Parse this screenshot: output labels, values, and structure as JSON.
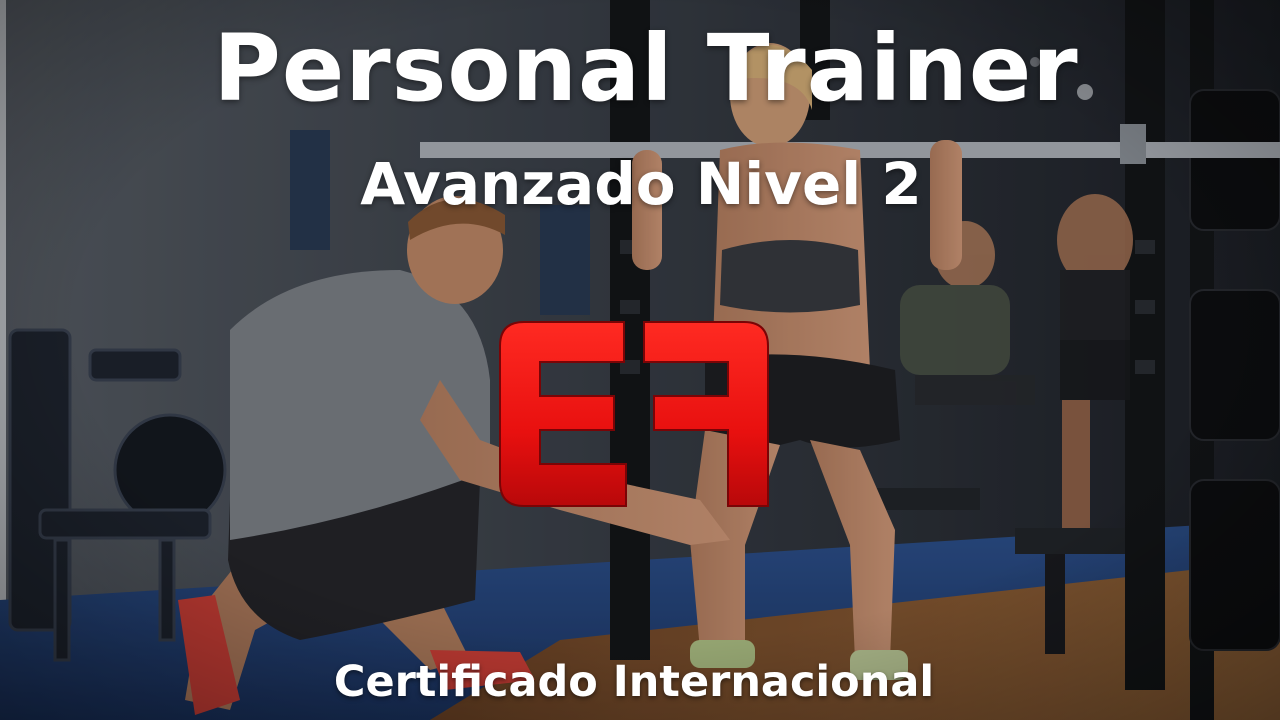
{
  "banner": {
    "title": "Personal Trainer",
    "subtitle": "Avanzado Nivel 2",
    "footer": "Certificado Internacional"
  },
  "logo": {
    "letters": "EF",
    "color": "#e8100f"
  },
  "colors": {
    "text": "#ffffff",
    "logo_red": "#e8100f",
    "floor_blue": "#2c4f8a",
    "wood_floor": "#8a5a32"
  }
}
